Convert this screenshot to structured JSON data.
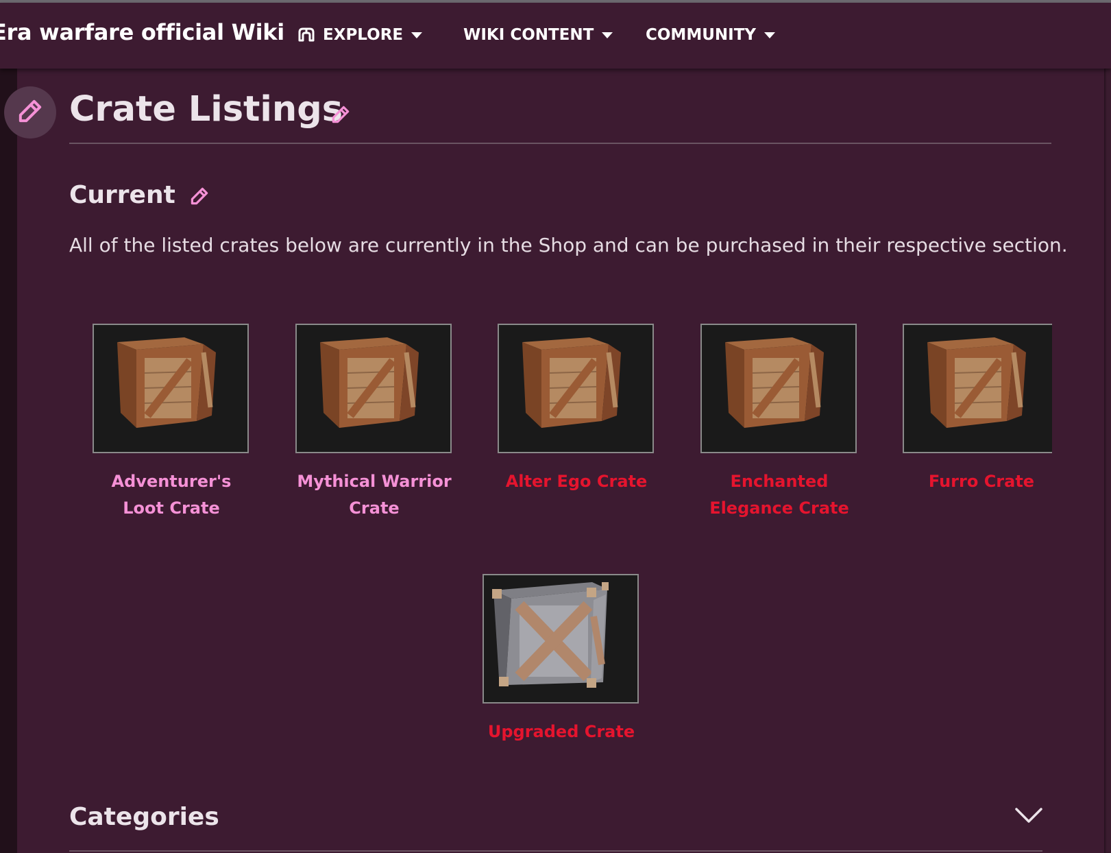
{
  "site": {
    "title": "Era warfare official Wiki"
  },
  "nav": {
    "explore": "EXPLORE",
    "wiki_content": "WIKI CONTENT",
    "community": "COMMUNITY"
  },
  "page": {
    "title": "Crate Listings",
    "section_heading": "Current",
    "intro": "All of the listed crates below are currently in the Shop and can be purchased in their respective section."
  },
  "crates": [
    {
      "line1": "Adventurer's",
      "line2": "Loot Crate",
      "link_state": "existing",
      "icon": "wooden-crate-icon"
    },
    {
      "line1": "Mythical Warrior",
      "line2": "Crate",
      "link_state": "existing",
      "icon": "wooden-crate-icon"
    },
    {
      "line1": "Alter Ego Crate",
      "line2": "",
      "link_state": "missing",
      "icon": "wooden-crate-icon"
    },
    {
      "line1": "Enchanted",
      "line2": "Elegance Crate",
      "link_state": "missing",
      "icon": "wooden-crate-icon"
    },
    {
      "line1": "Furro Crate",
      "line2": "",
      "link_state": "missing",
      "icon": "wooden-crate-icon"
    },
    {
      "line1": "Upgraded Crate",
      "line2": "",
      "link_state": "missing",
      "icon": "metal-crate-icon"
    }
  ],
  "categories": {
    "label": "Categories"
  },
  "colors": {
    "background": "#3d1b31",
    "existing_link": "#f591d6",
    "missing_link": "#e5142e",
    "accent": "#f591d6"
  }
}
